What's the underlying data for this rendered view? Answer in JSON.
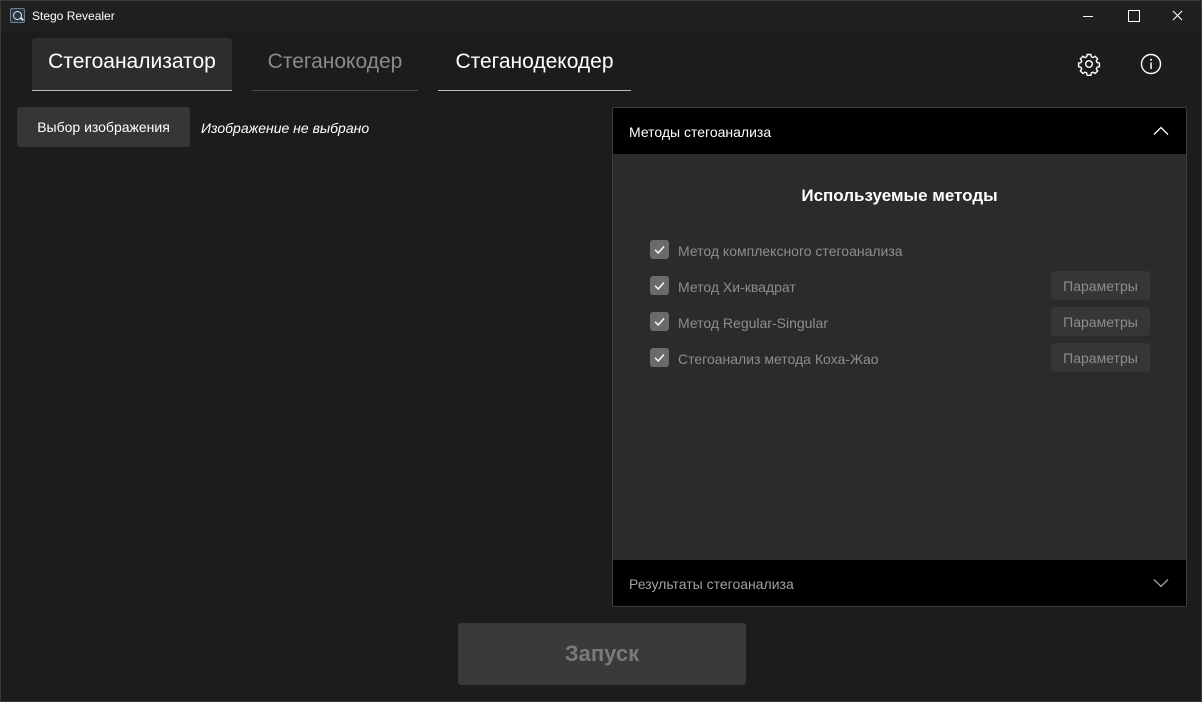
{
  "window": {
    "title": "Stego Revealer"
  },
  "tabs": [
    {
      "label": "Стегоанализатор",
      "state": "selected"
    },
    {
      "label": "Стеганокодер",
      "state": "disabled"
    },
    {
      "label": "Стеганодекодер",
      "state": "normal"
    }
  ],
  "toolbar": {
    "settings_icon": "gear-icon",
    "info_icon": "info-icon"
  },
  "image_select": {
    "button_label": "Выбор изображения",
    "status": "Изображение не выбрано"
  },
  "methods_panel": {
    "header": "Методы стегоанализа",
    "expanded": true,
    "section_title": "Используемые методы",
    "methods": [
      {
        "label": "Метод комплексного стегоанализа",
        "checked": true,
        "params_label": ""
      },
      {
        "label": "Метод Хи-квадрат",
        "checked": true,
        "params_label": "Параметры"
      },
      {
        "label": "Метод Regular-Singular",
        "checked": true,
        "params_label": "Параметры"
      },
      {
        "label": "Стегоанализ метода Коха-Жао",
        "checked": true,
        "params_label": "Параметры"
      }
    ]
  },
  "results_panel": {
    "header": "Результаты стегоанализа",
    "expanded": false
  },
  "run_button": {
    "label": "Запуск",
    "enabled": false
  },
  "colors": {
    "background": "#1c1c1c",
    "panel_header": "#000000",
    "panel_body": "#2b2b2b",
    "button": "#363636",
    "disabled_text": "#8d8d8d"
  }
}
